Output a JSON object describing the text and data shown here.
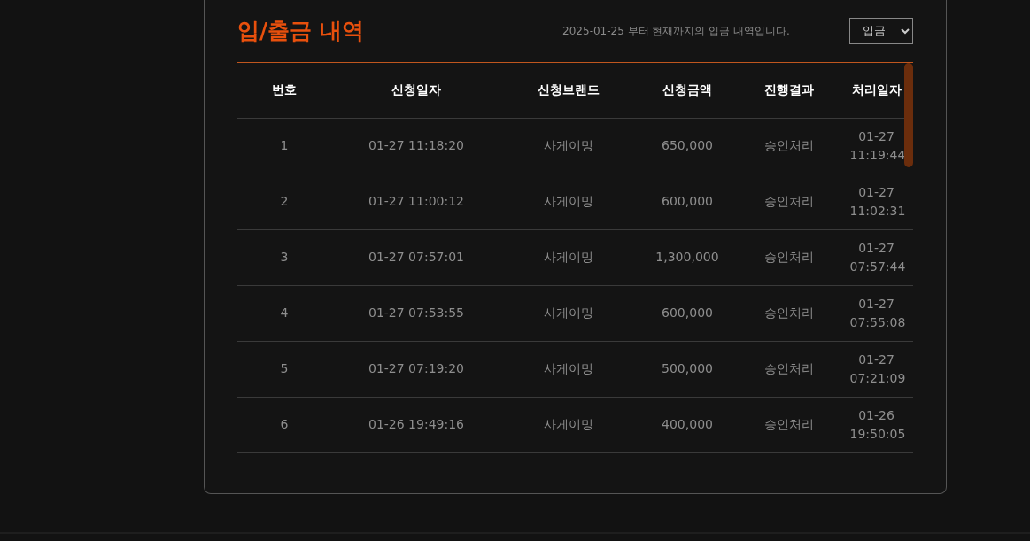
{
  "title": "입/출금 내역",
  "notice": "2025-01-25 부터 현재까지의 입금 내역입니다.",
  "filter": {
    "value": "입금"
  },
  "table": {
    "columns": [
      "번호",
      "신청일자",
      "신청브랜드",
      "신청금액",
      "진행결과",
      "처리일자"
    ],
    "rows": [
      [
        "1",
        "01-27 11:18:20",
        "사게이밍",
        "650,000",
        "승인처리",
        "01-27 11:19:44"
      ],
      [
        "2",
        "01-27 11:00:12",
        "사게이밍",
        "600,000",
        "승인처리",
        "01-27 11:02:31"
      ],
      [
        "3",
        "01-27 07:57:01",
        "사게이밍",
        "1,300,000",
        "승인처리",
        "01-27 07:57:44"
      ],
      [
        "4",
        "01-27 07:53:55",
        "사게이밍",
        "600,000",
        "승인처리",
        "01-27 07:55:08"
      ],
      [
        "5",
        "01-27 07:19:20",
        "사게이밍",
        "500,000",
        "승인처리",
        "01-27 07:21:09"
      ],
      [
        "6",
        "01-26 19:49:16",
        "사게이밍",
        "400,000",
        "승인처리",
        "01-26 19:50:05"
      ]
    ]
  }
}
